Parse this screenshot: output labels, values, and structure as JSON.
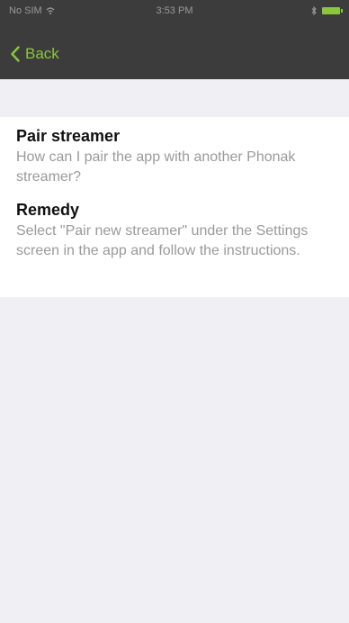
{
  "status_bar": {
    "carrier": "No SIM",
    "time": "3:53 PM"
  },
  "nav": {
    "back_label": "Back"
  },
  "colors": {
    "accent": "#8cc63f",
    "nav_background": "#3c3c3c",
    "page_background": "#f0f0f4"
  },
  "faq": {
    "question_title": "Pair streamer",
    "question_text": "How can I pair the app with another Phonak streamer?",
    "remedy_title": "Remedy",
    "remedy_text": "Select \"Pair new streamer\" under the Settings screen in the app and follow the instructions."
  }
}
